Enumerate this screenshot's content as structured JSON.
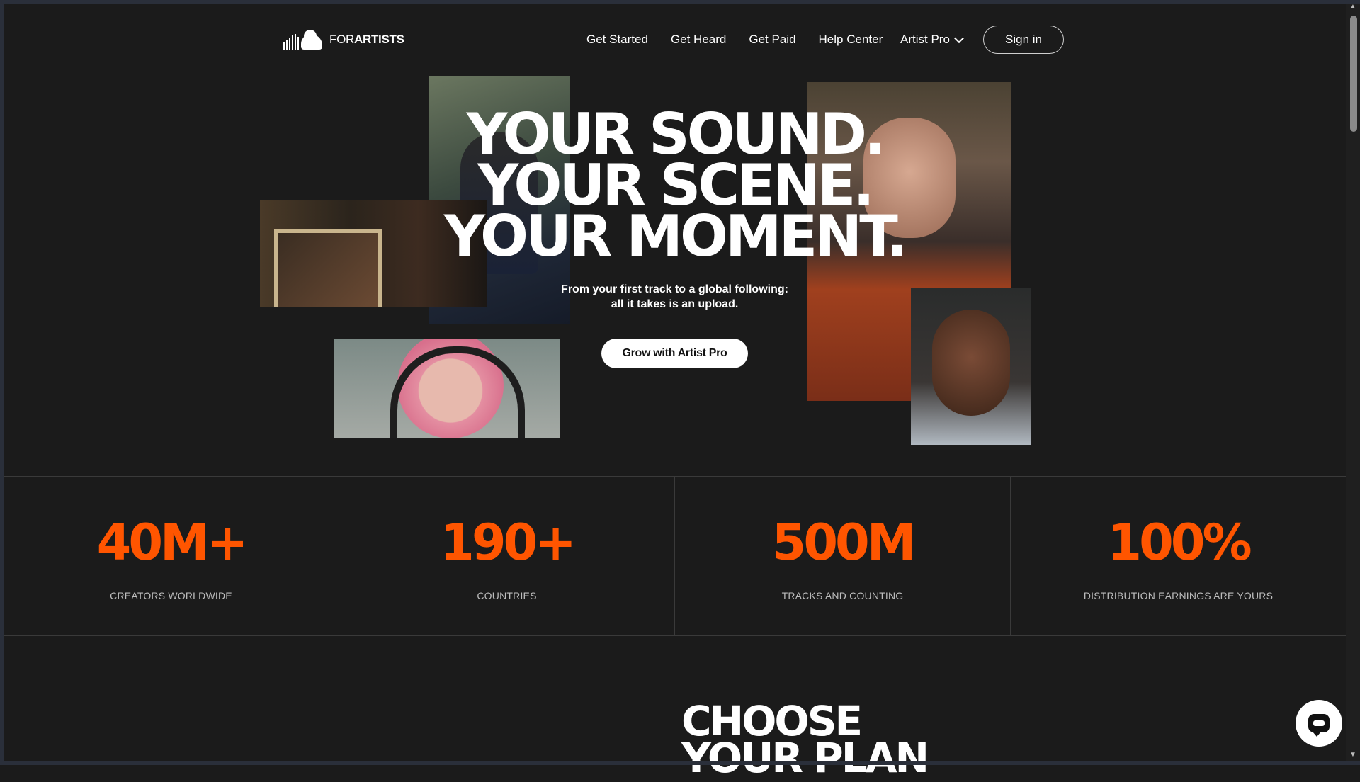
{
  "nav": {
    "logo_thin": "FOR",
    "logo_bold": "ARTISTS",
    "links": [
      "Get Started",
      "Get Heard",
      "Get Paid",
      "Help Center"
    ],
    "artist_pro": "Artist Pro",
    "sign_in": "Sign in"
  },
  "hero": {
    "line1": "YOUR SOUND.",
    "line2": "YOUR SCENE.",
    "line3": "YOUR MOMENT.",
    "sub1": "From your first track to a global following:",
    "sub2": "all it takes is an upload.",
    "cta": "Grow with Artist Pro"
  },
  "stats": [
    {
      "value": "40M+",
      "label": "CREATORS WORLDWIDE"
    },
    {
      "value": "190+",
      "label": "COUNTRIES"
    },
    {
      "value": "500M",
      "label": "TRACKS AND COUNTING"
    },
    {
      "value": "100%",
      "label": "DISTRIBUTION EARNINGS ARE YOURS"
    }
  ],
  "plans": {
    "title1": "CHOOSE",
    "title2": "YOUR PLAN"
  },
  "colors": {
    "accent": "#ff5500",
    "background": "#1b1b1b"
  },
  "icons": {
    "logo": "soundcloud-logo-icon",
    "dropdown": "chevron-down-icon",
    "chat": "chat-bubble-icon"
  }
}
